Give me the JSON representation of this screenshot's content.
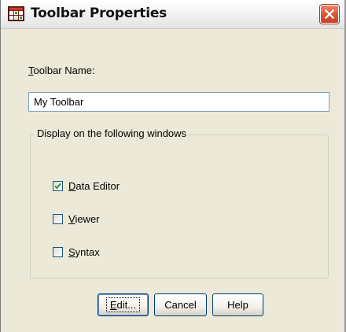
{
  "window": {
    "title": "Toolbar Properties",
    "app_icon": "toolbar-grid-icon",
    "close_icon": "close-x-icon"
  },
  "form": {
    "name_label": "Toolbar Name:",
    "name_label_mnemonic": "T",
    "name_label_rest": "oolbar Name:",
    "name_value": "My Toolbar"
  },
  "display_group": {
    "legend": "Display on the following windows",
    "options": [
      {
        "mnemonic": "D",
        "rest": "ata Editor",
        "checked": true
      },
      {
        "mnemonic": "V",
        "rest": "iewer",
        "checked": false
      },
      {
        "mnemonic": "S",
        "rest": "yntax",
        "checked": false
      }
    ]
  },
  "buttons": {
    "edit_mnemonic": "E",
    "edit_rest": "dit...",
    "cancel": "Cancel",
    "help": "Help"
  },
  "colors": {
    "dialog_bg": "#ece9d8",
    "close_red": "#d9573a",
    "button_border": "#003c74"
  }
}
